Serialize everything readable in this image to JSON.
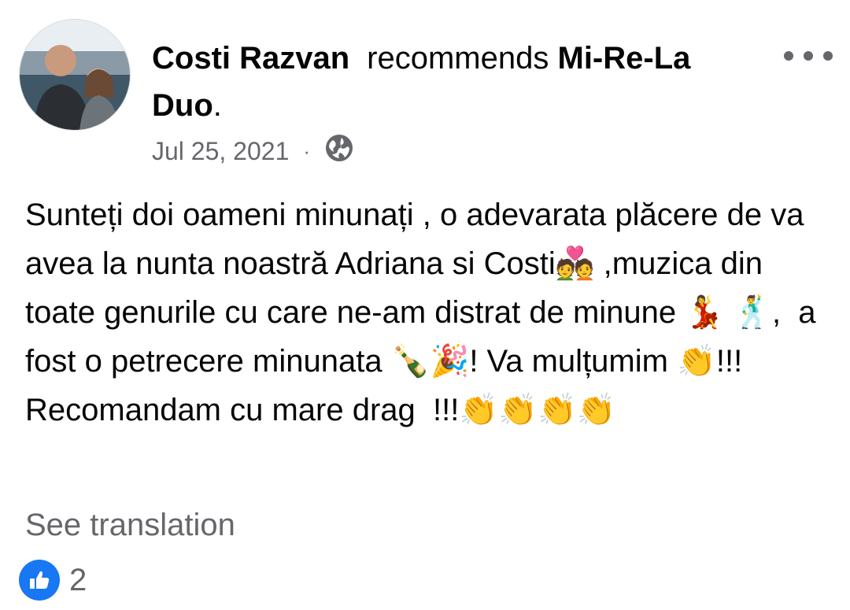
{
  "post": {
    "author": "Costi Razvan",
    "action": "recommends",
    "page_name": "Mi-Re-La Duo",
    "page_suffix": ".",
    "date": "Jul 25, 2021",
    "separator": "·",
    "audience_icon": "globe-icon",
    "more_icon": "more-options-icon",
    "body": "Sunteți doi oameni minunați , o adevarata plăcere de va avea la nunta noastră Adriana si Costi💑 ,muzica din toate genurile cu care ne-am distrat de minune 💃 🕺,  a fost o petrecere minunata 🍾🎉! Va mulțumim 👏!!! Recomandam cu mare drag  !!!👏👏👏👏",
    "see_translation": "See translation",
    "reaction_icon": "like-icon",
    "reaction_count": "2"
  },
  "colors": {
    "text": "#050505",
    "secondary": "#65676b",
    "like_blue": "#1877f2"
  }
}
